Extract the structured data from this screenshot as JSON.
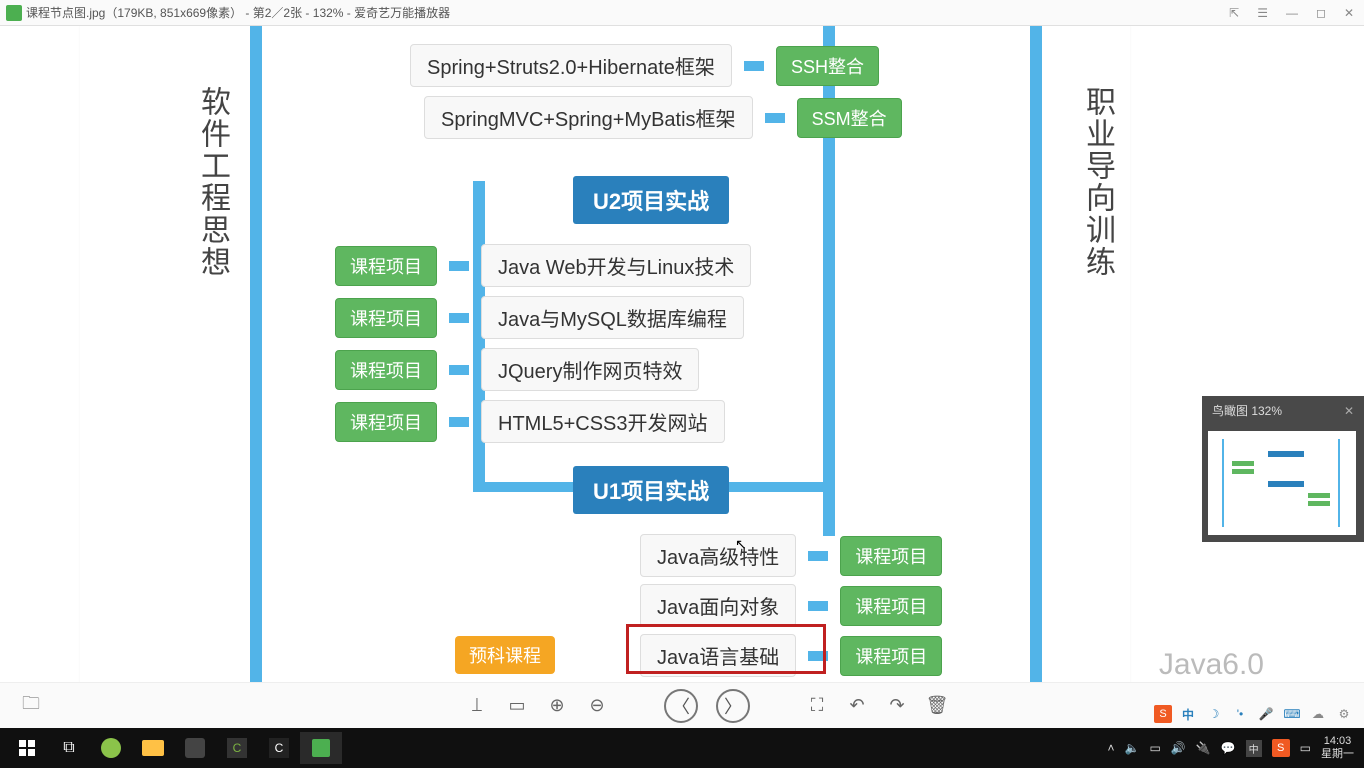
{
  "titlebar": {
    "filename": "课程节点图.jpg（179KB, 851x669像素） - 第2／2张 - 132% - 爱奇艺万能播放器"
  },
  "leftVText": "软件工程思想",
  "rightVText": "职业导向训练",
  "rows": {
    "top1": {
      "grey": "Spring+Struts2.0+Hibernate框架",
      "green": "SSH整合"
    },
    "top2": {
      "grey": "SpringMVC+Spring+MyBatis框架",
      "green": "SSM整合"
    },
    "u2header": "U2项目实战",
    "mid1": {
      "green": "课程项目",
      "grey": "Java Web开发与Linux技术"
    },
    "mid2": {
      "green": "课程项目",
      "grey": "Java与MySQL数据库编程"
    },
    "mid3": {
      "green": "课程项目",
      "grey": "JQuery制作网页特效"
    },
    "mid4": {
      "green": "课程项目",
      "grey": "HTML5+CSS3开发网站"
    },
    "u1header": "U1项目实战",
    "bot1": {
      "grey": "Java高级特性",
      "green": "课程项目"
    },
    "bot2": {
      "grey": "Java面向对象",
      "green": "课程项目"
    },
    "bot3": {
      "grey": "Java语言基础",
      "green": "课程项目"
    },
    "precourse": "预科课程"
  },
  "thumbnail": {
    "label": "鸟瞰图  132%"
  },
  "bottomVersion": "Java6.0",
  "toolbar": {
    "archive": "⎚",
    "crop": "▭",
    "fit": "⛶",
    "zoomIn": "⊕",
    "zoomOut": "⊖",
    "prev": "〈",
    "next": "〉",
    "screen": "⎚",
    "rotL": "↶",
    "rotR": "↷",
    "del": "🗑"
  },
  "tray": {
    "time": "14:03",
    "day": "星期一"
  },
  "ime": {
    "s": "S",
    "zhong": "中"
  }
}
